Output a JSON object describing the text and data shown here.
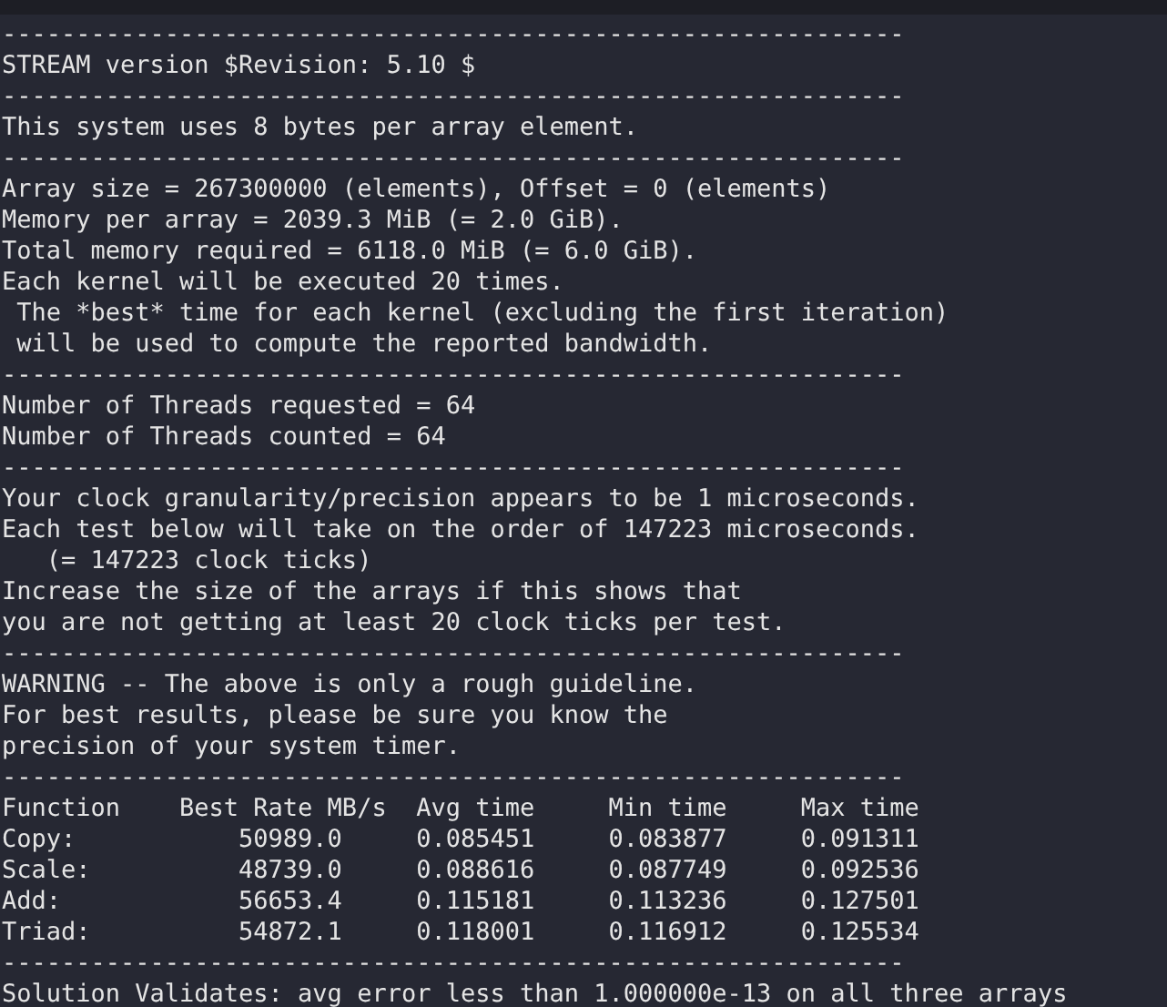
{
  "terminal": {
    "blocks": [
      {
        "kind": "rule",
        "text": "-------------------------------------------------------------"
      },
      {
        "kind": "text",
        "text": "STREAM version $Revision: 5.10 $"
      },
      {
        "kind": "rule",
        "text": "-------------------------------------------------------------"
      },
      {
        "kind": "text",
        "text": "This system uses 8 bytes per array element."
      },
      {
        "kind": "rule",
        "text": "-------------------------------------------------------------"
      },
      {
        "kind": "text",
        "text": "Array size = 267300000 (elements), Offset = 0 (elements)"
      },
      {
        "kind": "text",
        "text": "Memory per array = 2039.3 MiB (= 2.0 GiB)."
      },
      {
        "kind": "text",
        "text": "Total memory required = 6118.0 MiB (= 6.0 GiB)."
      },
      {
        "kind": "text",
        "text": "Each kernel will be executed 20 times."
      },
      {
        "kind": "text",
        "text": " The *best* time for each kernel (excluding the first iteration)"
      },
      {
        "kind": "text",
        "text": " will be used to compute the reported bandwidth."
      },
      {
        "kind": "rule",
        "text": "-------------------------------------------------------------"
      },
      {
        "kind": "text",
        "text": "Number of Threads requested = 64"
      },
      {
        "kind": "text",
        "text": "Number of Threads counted = 64"
      },
      {
        "kind": "rule",
        "text": "-------------------------------------------------------------"
      },
      {
        "kind": "text",
        "text": "Your clock granularity/precision appears to be 1 microseconds."
      },
      {
        "kind": "text",
        "text": "Each test below will take on the order of 147223 microseconds."
      },
      {
        "kind": "text",
        "text": "   (= 147223 clock ticks)"
      },
      {
        "kind": "text",
        "text": "Increase the size of the arrays if this shows that"
      },
      {
        "kind": "text",
        "text": "you are not getting at least 20 clock ticks per test."
      },
      {
        "kind": "rule",
        "text": "-------------------------------------------------------------"
      },
      {
        "kind": "text",
        "text": "WARNING -- The above is only a rough guideline."
      },
      {
        "kind": "text",
        "text": "For best results, please be sure you know the"
      },
      {
        "kind": "text",
        "text": "precision of your system timer."
      },
      {
        "kind": "rule",
        "text": "-------------------------------------------------------------"
      },
      {
        "kind": "table",
        "columns": [
          "Function",
          "Best Rate MB/s",
          "Avg time",
          "Min time",
          "Max time"
        ],
        "rows": [
          [
            "Copy:",
            "50989.0",
            "0.085451",
            "0.083877",
            "0.091311"
          ],
          [
            "Scale:",
            "48739.0",
            "0.088616",
            "0.087749",
            "0.092536"
          ],
          [
            "Add:",
            "56653.4",
            "0.115181",
            "0.113236",
            "0.127501"
          ],
          [
            "Triad:",
            "54872.1",
            "0.118001",
            "0.116912",
            "0.125534"
          ]
        ]
      },
      {
        "kind": "rule",
        "text": "-------------------------------------------------------------"
      },
      {
        "kind": "text",
        "text": "Solution Validates: avg error less than 1.000000e-13 on all three arrays"
      }
    ]
  }
}
